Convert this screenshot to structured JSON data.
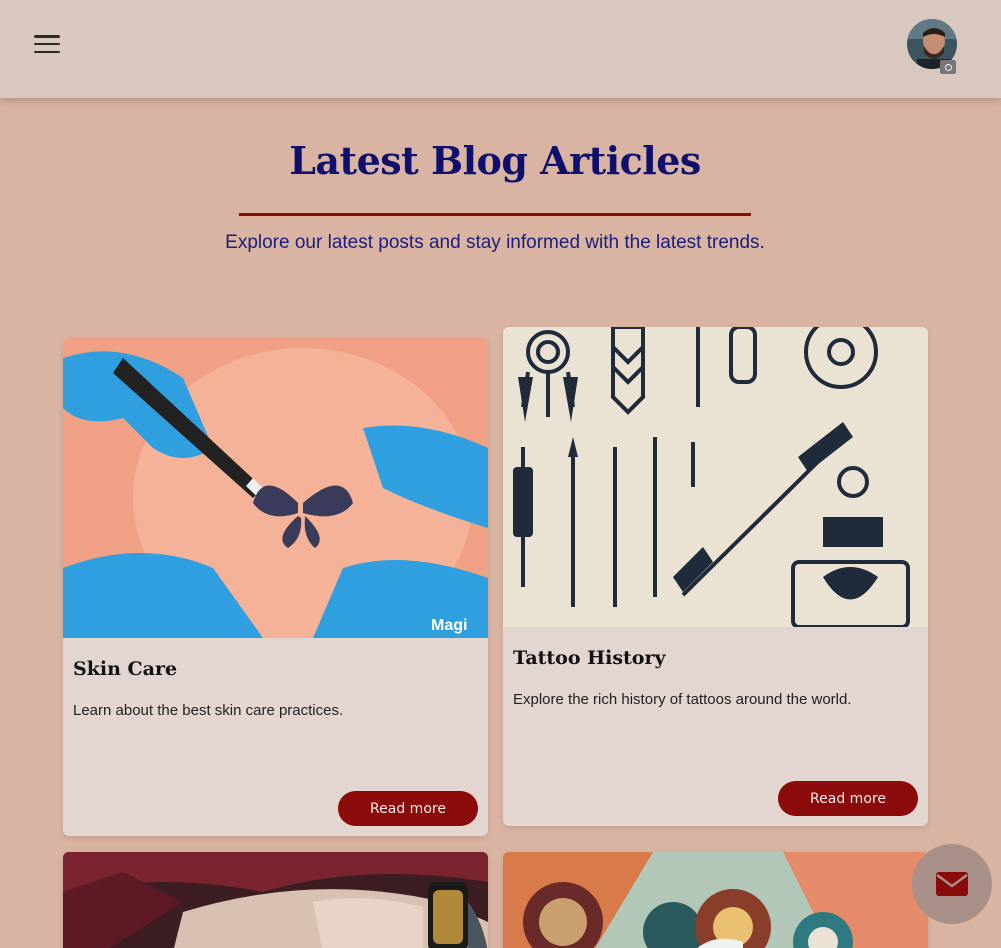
{
  "header": {
    "menu_icon": "hamburger-menu-icon",
    "avatar_icon": "user-avatar",
    "camera_icon": "camera-icon"
  },
  "section": {
    "title": "Latest Blog Articles",
    "subtitle": "Explore our latest posts and stay informed with the latest trends."
  },
  "cards": [
    {
      "title": "Skin Care",
      "description": "Learn about the best skin care practices.",
      "button": "Read more",
      "watermark": "Magi"
    },
    {
      "title": "Tattoo History",
      "description": "Explore the rich history of tattoos around the world.",
      "button": "Read more"
    }
  ],
  "fab": {
    "icon": "envelope-icon"
  },
  "colors": {
    "background": "#d9b4a2",
    "header": "#d9c8c0",
    "title": "#0f0f6e",
    "accent": "#8b0a0a",
    "card": "#e3d6d0"
  }
}
